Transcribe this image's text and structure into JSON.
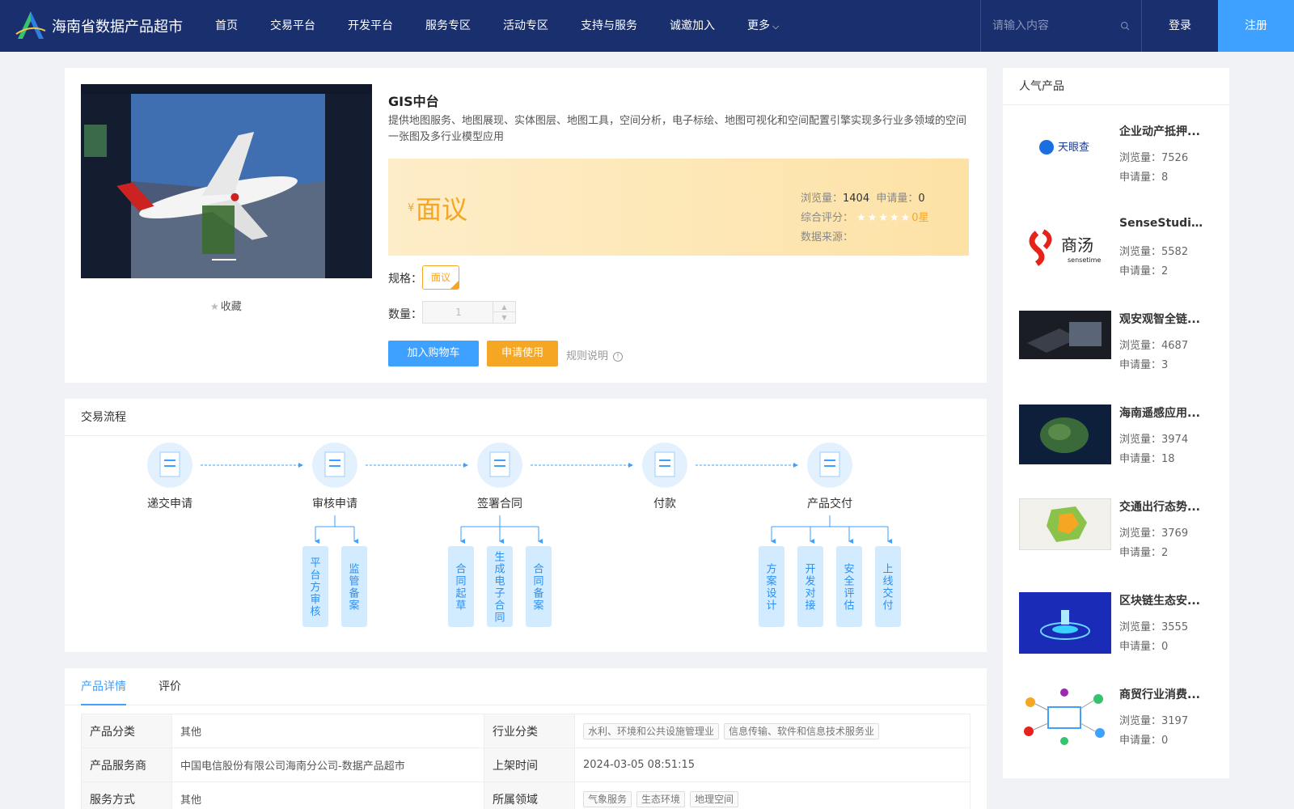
{
  "header": {
    "site_title": "海南省数据产品超市",
    "nav": [
      "首页",
      "交易平台",
      "开发平台",
      "服务专区",
      "活动专区",
      "支持与服务",
      "诚邀加入",
      "更多"
    ],
    "search_placeholder": "请输入内容",
    "login": "登录",
    "register": "注册",
    "colors": {
      "bg": "#1a2f6e",
      "register_bg": "#3ea0ff"
    }
  },
  "product": {
    "title": "GIS中台",
    "description": "提供地图服务、地图展现、实体图层、地图工具，空间分析，电子标绘、地图可视化和空间配置引擎实现多行业多领域的空间一张图及多行业模型应用",
    "currency": "¥",
    "price": "面议",
    "views_label": "浏览量：",
    "views": "1404",
    "applies_label": "申请量：",
    "applies": "0",
    "rating_label": "综合评分：",
    "stars": "★★★★★",
    "rating": "0星",
    "source_label": "数据来源：",
    "spec_label": "规格：",
    "spec_value": "面议",
    "qty_label": "数量：",
    "qty_value": "1",
    "collect": "收藏",
    "btn_cart": "加入购物车",
    "btn_apply": "申请使用",
    "rules": "规则说明",
    "colors": {
      "accent": "#f5a623",
      "primary": "#3ea0ff"
    }
  },
  "flow": {
    "title": "交易流程",
    "steps": [
      "递交申请",
      "审核申请",
      "签署合同",
      "付款",
      "产品交付"
    ],
    "substeps": {
      "审核申请": [
        "平台方审核",
        "监管备案"
      ],
      "签署合同": [
        "合同起草",
        "生成电子合同",
        "合同备案"
      ],
      "产品交付": [
        "方案设计",
        "开发对接",
        "安全评估",
        "上线交付"
      ]
    }
  },
  "detail": {
    "tabs": [
      "产品详情",
      "评价"
    ],
    "rows": [
      {
        "k1": "产品分类",
        "v1": "其他",
        "k2": "行业分类",
        "chips": [
          "水利、环境和公共设施管理业",
          "信息传输、软件和信息技术服务业"
        ]
      },
      {
        "k1": "产品服务商",
        "v1": "中国电信股份有限公司海南分公司-数据产品超市",
        "k2": "上架时间",
        "v2": "2024-03-05 08:51:15"
      },
      {
        "k1": "服务方式",
        "v1": "其他",
        "k2": "所属领域",
        "chips": [
          "气象服务",
          "生态环境",
          "地理空间"
        ]
      }
    ]
  },
  "sidebar": {
    "title": "人气产品",
    "items": [
      {
        "title": "企业动产抵押...",
        "views": "浏览量：7526",
        "applies": "申请量：8",
        "thumb": "tianyancha-logo"
      },
      {
        "title": "SenseStudio...",
        "views": "浏览量：5582",
        "applies": "申请量：2",
        "thumb": "sensetime-logo"
      },
      {
        "title": "观安观智全链...",
        "views": "浏览量：4687",
        "applies": "申请量：3",
        "thumb": "device-photo"
      },
      {
        "title": "海南遥感应用...",
        "views": "浏览量：3974",
        "applies": "申请量：18",
        "thumb": "satellite-map"
      },
      {
        "title": "交通出行态势...",
        "views": "浏览量：3769",
        "applies": "申请量：2",
        "thumb": "traffic-map"
      },
      {
        "title": "区块链生态安...",
        "views": "浏览量：3555",
        "applies": "申请量：0",
        "thumb": "blockchain-art"
      },
      {
        "title": "商贸行业消费...",
        "views": "浏览量：3197",
        "applies": "申请量：0",
        "thumb": "network-diagram"
      }
    ],
    "logo_text": {
      "tianyancha": "天眼查",
      "sensetime_cn": "商汤",
      "sensetime_en": "sensetime"
    }
  }
}
